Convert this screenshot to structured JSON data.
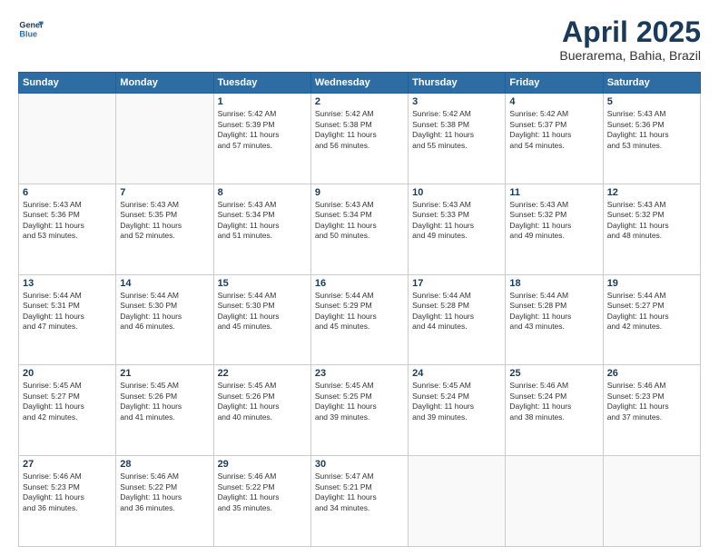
{
  "header": {
    "logo_line1": "General",
    "logo_line2": "Blue",
    "month": "April 2025",
    "location": "Buerarema, Bahia, Brazil"
  },
  "weekdays": [
    "Sunday",
    "Monday",
    "Tuesday",
    "Wednesday",
    "Thursday",
    "Friday",
    "Saturday"
  ],
  "rows": [
    [
      {
        "day": "",
        "text": ""
      },
      {
        "day": "",
        "text": ""
      },
      {
        "day": "1",
        "text": "Sunrise: 5:42 AM\nSunset: 5:39 PM\nDaylight: 11 hours\nand 57 minutes."
      },
      {
        "day": "2",
        "text": "Sunrise: 5:42 AM\nSunset: 5:38 PM\nDaylight: 11 hours\nand 56 minutes."
      },
      {
        "day": "3",
        "text": "Sunrise: 5:42 AM\nSunset: 5:38 PM\nDaylight: 11 hours\nand 55 minutes."
      },
      {
        "day": "4",
        "text": "Sunrise: 5:42 AM\nSunset: 5:37 PM\nDaylight: 11 hours\nand 54 minutes."
      },
      {
        "day": "5",
        "text": "Sunrise: 5:43 AM\nSunset: 5:36 PM\nDaylight: 11 hours\nand 53 minutes."
      }
    ],
    [
      {
        "day": "6",
        "text": "Sunrise: 5:43 AM\nSunset: 5:36 PM\nDaylight: 11 hours\nand 53 minutes."
      },
      {
        "day": "7",
        "text": "Sunrise: 5:43 AM\nSunset: 5:35 PM\nDaylight: 11 hours\nand 52 minutes."
      },
      {
        "day": "8",
        "text": "Sunrise: 5:43 AM\nSunset: 5:34 PM\nDaylight: 11 hours\nand 51 minutes."
      },
      {
        "day": "9",
        "text": "Sunrise: 5:43 AM\nSunset: 5:34 PM\nDaylight: 11 hours\nand 50 minutes."
      },
      {
        "day": "10",
        "text": "Sunrise: 5:43 AM\nSunset: 5:33 PM\nDaylight: 11 hours\nand 49 minutes."
      },
      {
        "day": "11",
        "text": "Sunrise: 5:43 AM\nSunset: 5:32 PM\nDaylight: 11 hours\nand 49 minutes."
      },
      {
        "day": "12",
        "text": "Sunrise: 5:43 AM\nSunset: 5:32 PM\nDaylight: 11 hours\nand 48 minutes."
      }
    ],
    [
      {
        "day": "13",
        "text": "Sunrise: 5:44 AM\nSunset: 5:31 PM\nDaylight: 11 hours\nand 47 minutes."
      },
      {
        "day": "14",
        "text": "Sunrise: 5:44 AM\nSunset: 5:30 PM\nDaylight: 11 hours\nand 46 minutes."
      },
      {
        "day": "15",
        "text": "Sunrise: 5:44 AM\nSunset: 5:30 PM\nDaylight: 11 hours\nand 45 minutes."
      },
      {
        "day": "16",
        "text": "Sunrise: 5:44 AM\nSunset: 5:29 PM\nDaylight: 11 hours\nand 45 minutes."
      },
      {
        "day": "17",
        "text": "Sunrise: 5:44 AM\nSunset: 5:28 PM\nDaylight: 11 hours\nand 44 minutes."
      },
      {
        "day": "18",
        "text": "Sunrise: 5:44 AM\nSunset: 5:28 PM\nDaylight: 11 hours\nand 43 minutes."
      },
      {
        "day": "19",
        "text": "Sunrise: 5:44 AM\nSunset: 5:27 PM\nDaylight: 11 hours\nand 42 minutes."
      }
    ],
    [
      {
        "day": "20",
        "text": "Sunrise: 5:45 AM\nSunset: 5:27 PM\nDaylight: 11 hours\nand 42 minutes."
      },
      {
        "day": "21",
        "text": "Sunrise: 5:45 AM\nSunset: 5:26 PM\nDaylight: 11 hours\nand 41 minutes."
      },
      {
        "day": "22",
        "text": "Sunrise: 5:45 AM\nSunset: 5:26 PM\nDaylight: 11 hours\nand 40 minutes."
      },
      {
        "day": "23",
        "text": "Sunrise: 5:45 AM\nSunset: 5:25 PM\nDaylight: 11 hours\nand 39 minutes."
      },
      {
        "day": "24",
        "text": "Sunrise: 5:45 AM\nSunset: 5:24 PM\nDaylight: 11 hours\nand 39 minutes."
      },
      {
        "day": "25",
        "text": "Sunrise: 5:46 AM\nSunset: 5:24 PM\nDaylight: 11 hours\nand 38 minutes."
      },
      {
        "day": "26",
        "text": "Sunrise: 5:46 AM\nSunset: 5:23 PM\nDaylight: 11 hours\nand 37 minutes."
      }
    ],
    [
      {
        "day": "27",
        "text": "Sunrise: 5:46 AM\nSunset: 5:23 PM\nDaylight: 11 hours\nand 36 minutes."
      },
      {
        "day": "28",
        "text": "Sunrise: 5:46 AM\nSunset: 5:22 PM\nDaylight: 11 hours\nand 36 minutes."
      },
      {
        "day": "29",
        "text": "Sunrise: 5:46 AM\nSunset: 5:22 PM\nDaylight: 11 hours\nand 35 minutes."
      },
      {
        "day": "30",
        "text": "Sunrise: 5:47 AM\nSunset: 5:21 PM\nDaylight: 11 hours\nand 34 minutes."
      },
      {
        "day": "",
        "text": ""
      },
      {
        "day": "",
        "text": ""
      },
      {
        "day": "",
        "text": ""
      }
    ]
  ]
}
